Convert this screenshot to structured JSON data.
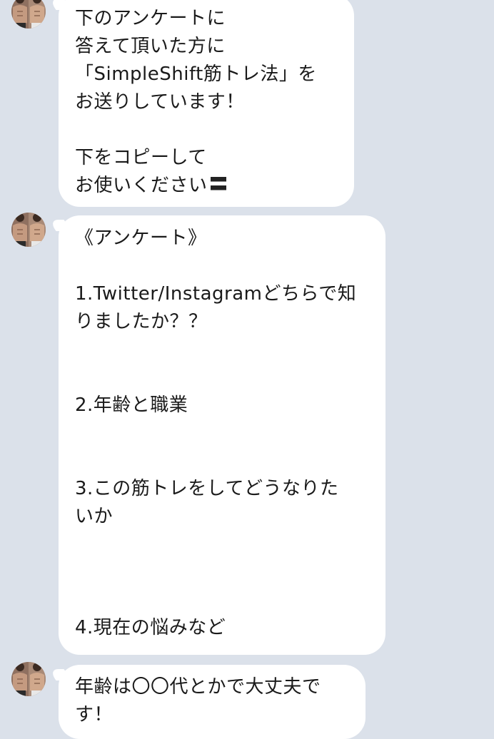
{
  "chat": {
    "messages": [
      {
        "sender_icon": "user-avatar",
        "text": "下のアンケートに\n答えて頂いた方に\n「SimpleShift筋トレ法」を\nお送りしています！\n\n下をコピーして\nお使いください",
        "trailing_emoji": "point-down-emoji"
      },
      {
        "sender_icon": "user-avatar",
        "text": "《アンケート》\n\n1.Twitter/Instagramどちらで知\nりましたか？？\n\n\n2.年齢と職業\n\n\n3.この筋トレをしてどうなりた\nいか\n\n\n\n4.現在の悩みなど"
      },
      {
        "sender_icon": "user-avatar",
        "text": "年齢は〇〇代とかで大丈夫で\nす！"
      }
    ]
  },
  "colors": {
    "background": "#dbe1ea",
    "bubble": "#ffffff",
    "text": "#1a1a1a"
  }
}
